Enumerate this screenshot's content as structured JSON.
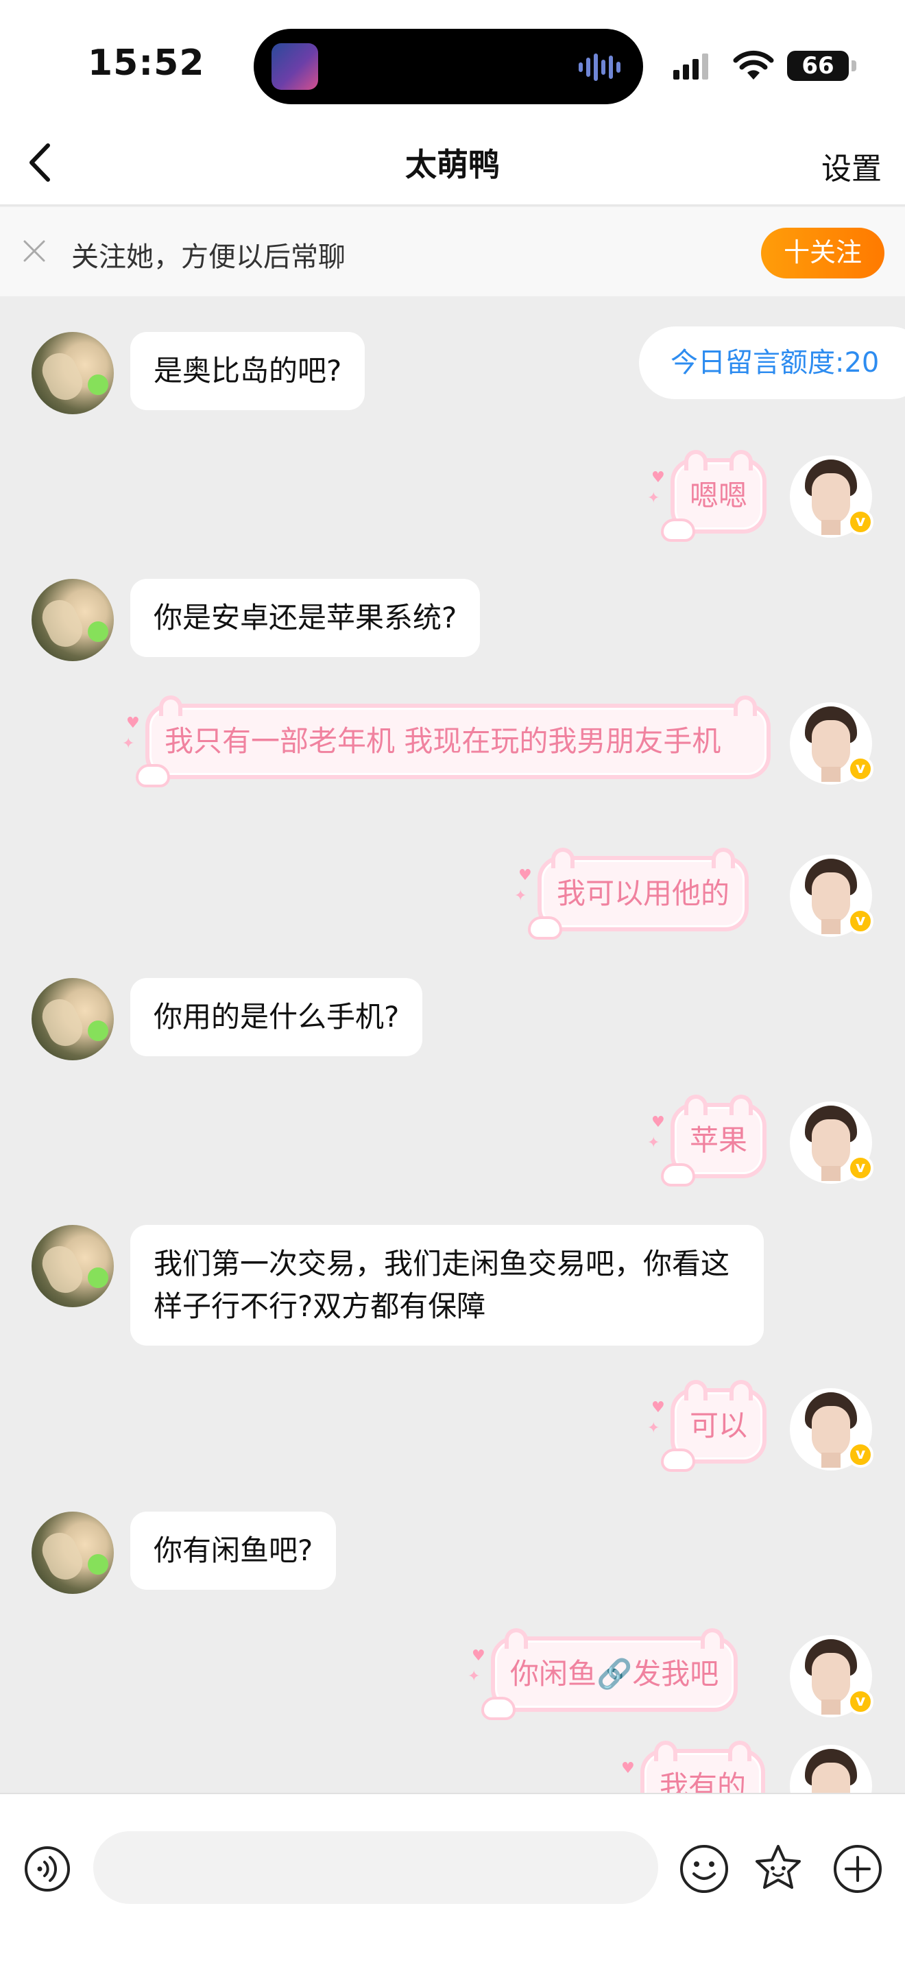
{
  "status": {
    "time": "15:52",
    "battery": "66"
  },
  "nav": {
    "title": "太萌鸭",
    "settings_label": "设置"
  },
  "follow_bar": {
    "text": "关注她，方便以后常聊",
    "button": "十关注"
  },
  "quota": "今日留言额度:20",
  "messages": [
    {
      "side": "left",
      "text": "是奥比岛的吧?"
    },
    {
      "side": "right",
      "text": "嗯嗯"
    },
    {
      "side": "left",
      "text": "你是安卓还是苹果系统?"
    },
    {
      "side": "right",
      "text": "我只有一部老年机 我现在玩的我男朋友手机"
    },
    {
      "side": "right",
      "text": "我可以用他的"
    },
    {
      "side": "left",
      "text": "你用的是什么手机?"
    },
    {
      "side": "right",
      "text": "苹果"
    },
    {
      "side": "left",
      "text": "我们第一次交易，我们走闲鱼交易吧，你看这样子行不行?双方都有保障"
    },
    {
      "side": "right",
      "text": "可以"
    },
    {
      "side": "left",
      "text": "你有闲鱼吧?"
    },
    {
      "side": "right",
      "text": "你闲鱼🔗发我吧"
    },
    {
      "side": "right",
      "text": "我有的"
    }
  ],
  "input": {
    "placeholder": ""
  },
  "colors": {
    "accent": "#ff8a00",
    "quota_text": "#2d8cf0",
    "bubble_pink_text": "#f0829f",
    "bubble_pink_border": "#ffd2df"
  }
}
